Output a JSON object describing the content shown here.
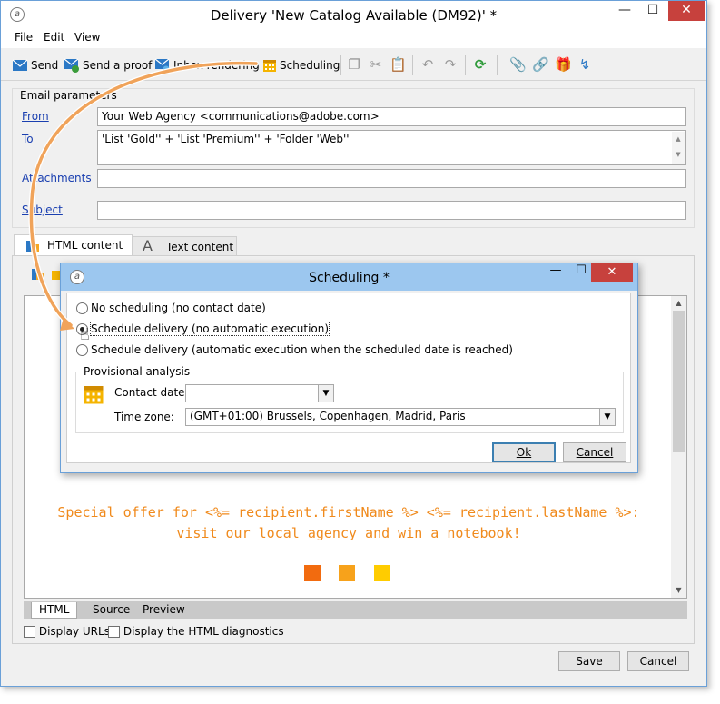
{
  "window": {
    "title": "Delivery 'New Catalog Available (DM92)' *",
    "app_icon": "adobe-campaign-icon",
    "min_symbol": "—",
    "max_symbol": "☐",
    "close_symbol": "✕"
  },
  "menu": [
    "File",
    "Edit",
    "View"
  ],
  "toolbar": {
    "send": "Send",
    "send_proof": "Send a proof",
    "inbox_rendering": "Inbox rendering",
    "scheduling": "Scheduling"
  },
  "email_params": {
    "title": "Email parameters",
    "from_label": "From",
    "from_value": "Your Web Agency <communications@adobe.com>",
    "to_label": "To",
    "to_value": "'List 'Gold'' + 'List 'Premium'' + 'Folder 'Web''",
    "attachments_label": "Attachments",
    "attachments_value": "",
    "subject_label": "Subject",
    "subject_value": ""
  },
  "content_tabs": {
    "html_tab": "HTML content",
    "text_tab": "Text content"
  },
  "editor": {
    "promo_line1": "Special offer for <%= recipient.firstName %> <%= recipient.lastName %>:",
    "promo_line2": "visit our local agency and win a notebook!",
    "swatch_colors": [
      "#f26b0f",
      "#f7a21b",
      "#ffcc00"
    ]
  },
  "bottom_tabs": [
    "HTML",
    "Source",
    "Preview"
  ],
  "checkboxes": {
    "display_urls": "Display URLs",
    "html_diagnostics": "Display the HTML diagnostics"
  },
  "footer": {
    "save": "Save",
    "cancel": "Cancel"
  },
  "dialog": {
    "title": "Scheduling *",
    "option_none": "No scheduling (no contact date)",
    "option_manual": "Schedule delivery (no automatic execution)",
    "option_auto": "Schedule delivery (automatic execution when the scheduled date is reached)",
    "selected_option": "option_manual",
    "analysis_title": "Provisional analysis",
    "contact_date_label": "Contact date:",
    "contact_date_value": "",
    "time_zone_label": "Time zone:",
    "time_zone_value": "(GMT+01:00) Brussels, Copenhagen, Madrid, Paris",
    "ok": "Ok",
    "cancel": "Cancel"
  },
  "colors": {
    "accent_orange": "#f08a1c",
    "link_blue": "#1a3fb0",
    "dialog_titlebar": "#9cc7ef",
    "close_red": "#c7413d"
  }
}
